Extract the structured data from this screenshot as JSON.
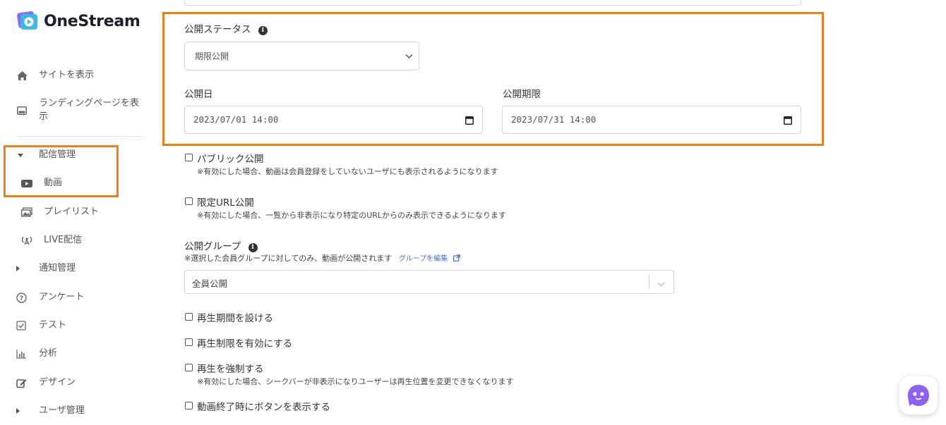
{
  "brand": {
    "name": "OneStream"
  },
  "sidebar": {
    "items": [
      {
        "label": "サイトを表示"
      },
      {
        "label": "ランディングページを表示"
      },
      {
        "label": "配信管理"
      },
      {
        "label": "動画"
      },
      {
        "label": "プレイリスト"
      },
      {
        "label": "LIVE配信"
      },
      {
        "label": "通知管理"
      },
      {
        "label": "アンケート"
      },
      {
        "label": "テスト"
      },
      {
        "label": "分析"
      },
      {
        "label": "デザイン"
      },
      {
        "label": "ユーザ管理"
      }
    ],
    "landing_label_line1": "ランディングページを表",
    "landing_label_line2": "示"
  },
  "form": {
    "publish_status": {
      "label": "公開ステータス",
      "value": "期限公開"
    },
    "publish_date": {
      "label": "公開日",
      "value": "2023/07/01 14:00"
    },
    "publish_deadline": {
      "label": "公開期限",
      "value": "2023/07/31 14:00"
    },
    "public_publish": {
      "label": "パブリック公開",
      "note": "※有効にした場合、動画は会員登録をしていないユーザにも表示されるようになります",
      "checked": false
    },
    "limited_url": {
      "label": "限定URL公開",
      "note": "※有効にした場合、一覧から非表示になり特定のURLからのみ表示できるようになります",
      "checked": false
    },
    "publish_group": {
      "label": "公開グループ",
      "note": "※選択した会員グループに対してのみ、動画が公開されます",
      "edit_link": "グループを編集",
      "value": "全員公開"
    },
    "playback_period": {
      "label": "再生期間を設ける",
      "checked": false
    },
    "playback_limit": {
      "label": "再生制限を有効にする",
      "checked": false
    },
    "force_playback": {
      "label": "再生を強制する",
      "note": "※有効にした場合、シークバーが非表示になりユーザーは再生位置を変更できなくなります",
      "checked": false
    },
    "end_button": {
      "label": "動画終了時にボタンを表示する",
      "checked": false
    }
  },
  "colors": {
    "highlight": "#e8821e",
    "accent": "#7b5cf0",
    "link": "#4a6fd8"
  }
}
